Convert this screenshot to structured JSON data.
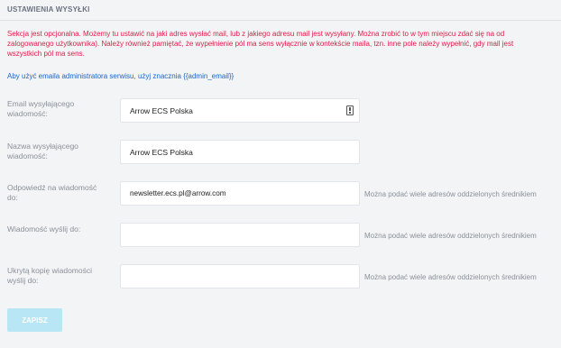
{
  "header": {
    "title": "USTAWIENIA WYSYŁKI"
  },
  "notice": {
    "lines": [
      "Sekcja jest opcjonalna. Możemy tu ustawić na jaki adres wysłać mail, lub z jakiego adresu mail jest wysyłany. Można zrobić to w tym miejscu zdać się na od",
      "zalogowanego użytkownika). Należy również pamiętać, że wypełnienie pól ma sens wyłącznie w kontekście maila, tzn. inne pole należy wypełnić, gdy mail jest",
      "wszystkich pól ma sens."
    ]
  },
  "admin_hint": "Aby użyć emaila administratora serwisu, użyj znacznia {{admin_email}}",
  "fields": [
    {
      "label_1": "Email wysyłającego",
      "label_2": "wiadomość:",
      "value": "Arrow ECS Polska",
      "hint": ""
    },
    {
      "label_1": "Nazwa wysyłającego",
      "label_2": "wiadomość:",
      "value": "Arrow ECS Polska",
      "hint": ""
    },
    {
      "label_1": "Odpowiedź na wiadomość",
      "label_2": "do:",
      "value": "newsletter.ecs.pl@arrow.com",
      "hint": "Można podać wiele adresów oddzielonych średnikiem"
    },
    {
      "label_1": "Wiadomość wyślij do:",
      "label_2": "",
      "value": "",
      "hint": "Można podać wiele adresów oddzielonych średnikiem"
    },
    {
      "label_1": "Ukrytą kopię wiadomości",
      "label_2": "wyślij do:",
      "value": "",
      "hint": "Można podać wiele adresów oddzielonych średnikiem"
    }
  ],
  "save_label": "ZAPISZ",
  "icons": {
    "field_icon": "contact-card-icon"
  },
  "colors": {
    "notice": "#e11d48",
    "link": "#1f63c8",
    "button": "#b9e6f5"
  }
}
